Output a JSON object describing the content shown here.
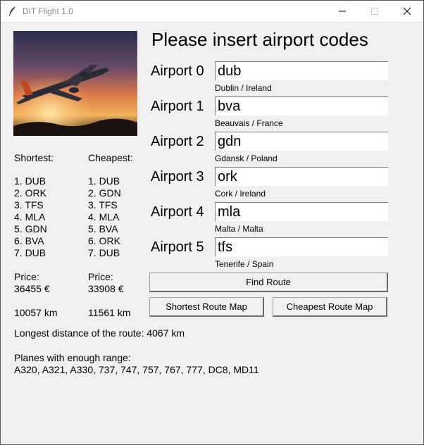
{
  "window": {
    "title": "DIT Flight 1.0",
    "icon": "feather-icon",
    "controls": [
      "minimize-icon",
      "maximize-icon",
      "close-icon"
    ]
  },
  "photo": {
    "subject": "airplane-at-sunset"
  },
  "heading": "Please insert airport codes",
  "airports": [
    {
      "label": "Airport 0",
      "value": "dub",
      "location": "Dublin / Ireland"
    },
    {
      "label": "Airport 1",
      "value": "bva",
      "location": "Beauvais / France"
    },
    {
      "label": "Airport 2",
      "value": "gdn",
      "location": "Gdansk / Poland"
    },
    {
      "label": "Airport 3",
      "value": "ork",
      "location": "Cork / Ireland"
    },
    {
      "label": "Airport 4",
      "value": "mla",
      "location": "Malta / Malta"
    },
    {
      "label": "Airport 5",
      "value": "tfs",
      "location": "Tenerife / Spain"
    }
  ],
  "shortest": {
    "title": "Shortest:",
    "route": [
      "1. DUB",
      "2. ORK",
      "3. TFS",
      "4. MLA",
      "5. GDN",
      "6. BVA",
      "7. DUB"
    ],
    "price_label": "Price:",
    "price": "36455 €",
    "distance": "10057 km"
  },
  "cheapest": {
    "title": "Cheapest:",
    "route": [
      "1. DUB",
      "2. GDN",
      "3. TFS",
      "4. MLA",
      "5. BVA",
      "6. ORK",
      "7. DUB"
    ],
    "price_label": "Price:",
    "price": "33908 €",
    "distance": "11561 km"
  },
  "buttons": {
    "find_route": "Find Route",
    "shortest_map": "Shortest Route Map",
    "cheapest_map": "Cheapest Route Map"
  },
  "longest_distance": "Longest distance of the route: 4067 km",
  "planes_label": "Planes with enough range:",
  "planes_list": "A320, A321, A330, 737, 747, 757, 767, 777, DC8, MD11"
}
